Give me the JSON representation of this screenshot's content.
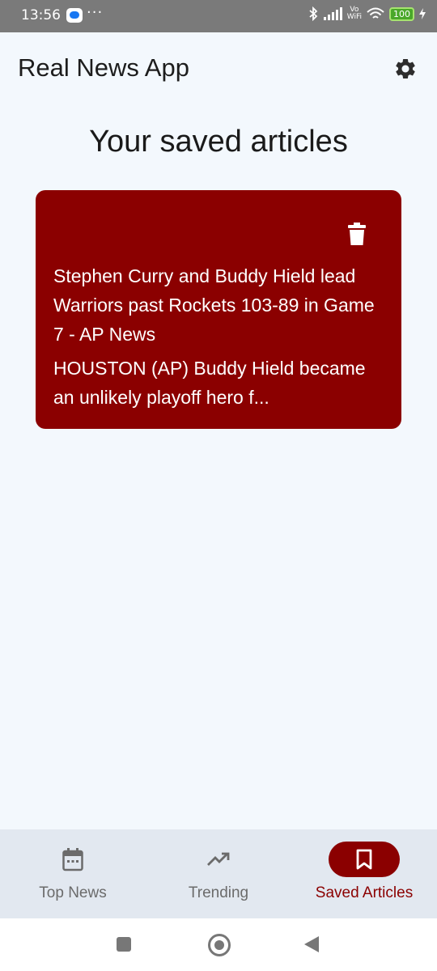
{
  "status_bar": {
    "time": "13:56",
    "dots": "···",
    "vo_label": "Vo",
    "wifi_label": "WiFi",
    "battery": "100"
  },
  "app_bar": {
    "title": "Real News App",
    "settings_icon": "gear-icon"
  },
  "page": {
    "heading": "Your saved articles"
  },
  "articles": [
    {
      "title": "Stephen Curry and Buddy Hield lead Warriors past Rockets 103-89 in Game 7 - AP News",
      "description": "HOUSTON (AP) Buddy Hield became an unlikely playoff hero f...",
      "action_icon": "trash-icon"
    }
  ],
  "bottom_nav": {
    "items": [
      {
        "label": "Top News",
        "icon": "calendar-icon",
        "active": false
      },
      {
        "label": "Trending",
        "icon": "trending-up-icon",
        "active": false
      },
      {
        "label": "Saved Articles",
        "icon": "bookmark-icon",
        "active": true
      }
    ]
  },
  "colors": {
    "accent": "#8b0000",
    "background": "#f3f8fd",
    "nav_background": "#e2e8f0"
  }
}
